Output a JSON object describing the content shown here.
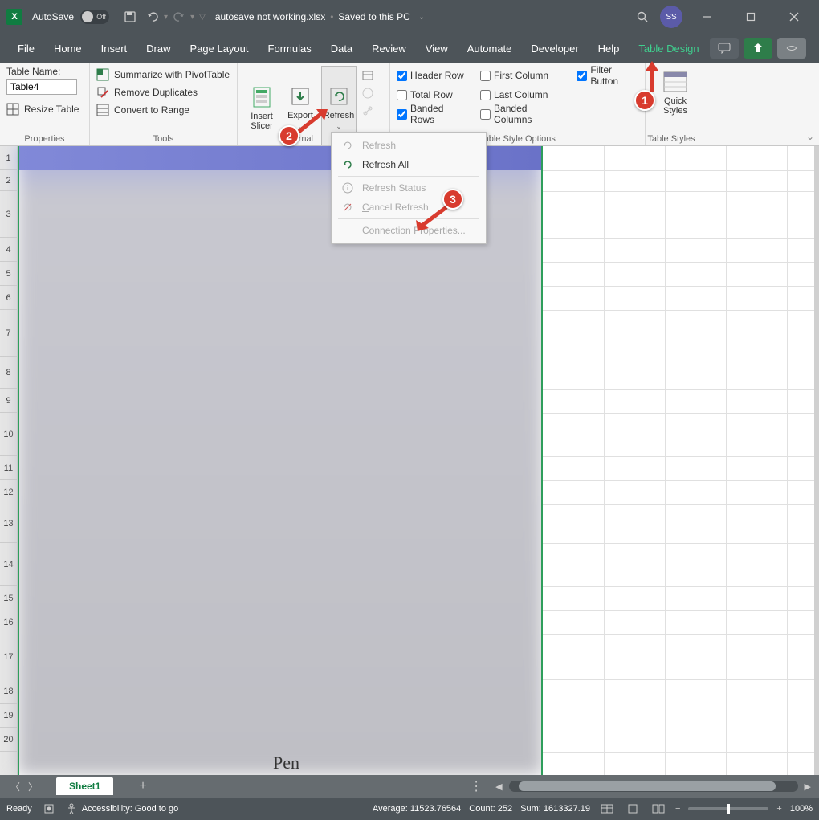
{
  "titlebar": {
    "app_icon": "X",
    "autosave_label": "AutoSave",
    "autosave_state": "Off",
    "filename": "autosave not working.xlsx",
    "save_status": "Saved to this PC",
    "user_initials": "SS"
  },
  "tabs": {
    "file": "File",
    "home": "Home",
    "insert": "Insert",
    "draw": "Draw",
    "page_layout": "Page Layout",
    "formulas": "Formulas",
    "data": "Data",
    "review": "Review",
    "view": "View",
    "automate": "Automate",
    "developer": "Developer",
    "help": "Help",
    "table_design": "Table Design"
  },
  "ribbon": {
    "properties": {
      "label": "Properties",
      "table_name_label": "Table Name:",
      "table_name_value": "Table4",
      "resize": "Resize Table"
    },
    "tools": {
      "label": "Tools",
      "pivot": "Summarize with PivotTable",
      "dupes": "Remove Duplicates",
      "convert": "Convert to Range"
    },
    "external": {
      "label": "xternal",
      "slicer": "Insert\nSlicer",
      "export": "Export",
      "refresh": "Refresh"
    },
    "style_options": {
      "label": "Table Style Options",
      "header_row": "Header Row",
      "total_row": "Total Row",
      "banded_rows": "Banded Rows",
      "first_column": "First Column",
      "last_column": "Last Column",
      "banded_columns": "Banded Columns",
      "filter_button": "Filter Button"
    },
    "styles": {
      "label": "Table Styles",
      "quick": "Quick\nStyles"
    }
  },
  "dropdown": {
    "refresh": "Refresh",
    "refresh_all": "Refresh All",
    "refresh_status": "Refresh Status",
    "cancel_refresh": "Cancel Refresh",
    "conn_props": "Connection Properties..."
  },
  "rows": [
    "1",
    "2",
    "3",
    "4",
    "5",
    "6",
    "7",
    "8",
    "9",
    "10",
    "11",
    "12",
    "13",
    "14",
    "15",
    "16",
    "17",
    "18",
    "19",
    "20"
  ],
  "pen_text": "Pen",
  "sheet_tabs": {
    "active": "Sheet1"
  },
  "statusbar": {
    "ready": "Ready",
    "accessibility": "Accessibility: Good to go",
    "average": "Average: 11523.76564",
    "count": "Count: 252",
    "sum": "Sum: 1613327.19",
    "zoom": "100%"
  },
  "callouts": {
    "c1": "1",
    "c2": "2",
    "c3": "3"
  }
}
